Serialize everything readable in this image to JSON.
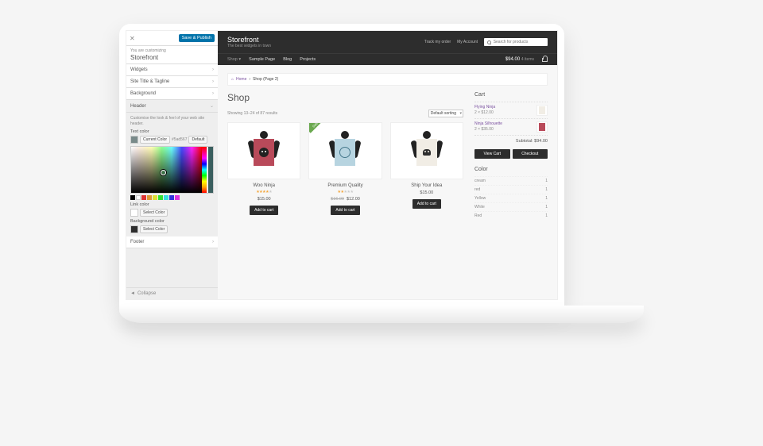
{
  "customizer": {
    "save": "Save & Publish",
    "crumb_pre": "You are customizing",
    "crumb_theme": "Storefront",
    "sections": [
      "Widgets",
      "Site Title & Tagline",
      "Background",
      "Header"
    ],
    "header": {
      "desc": "Customise the look & feel of your web site header.",
      "text_color": {
        "label": "Text color",
        "hex": "#5ad567",
        "current": "Current Color",
        "default": "Default"
      },
      "link_color": {
        "label": "Link color",
        "select": "Select Color"
      },
      "bg_color": {
        "label": "Background color",
        "select": "Select Color"
      }
    },
    "footer_section": "Footer",
    "collapse": "Collapse"
  },
  "site": {
    "brand": "Storefront",
    "tagline": "The best widgets in town",
    "links": {
      "track": "Track my order",
      "account": "My Account"
    },
    "search_placeholder": "Search for products",
    "nav": [
      "Shop",
      "Sample Page",
      "Blog",
      "Projects"
    ],
    "cart_total": "$94.00",
    "cart_items": "4 items",
    "breadcrumb": {
      "home": "Home",
      "shop": "Shop",
      "page": "(Page 2)"
    }
  },
  "shop": {
    "title": "Shop",
    "count": "Showing 13–24 of 87 results",
    "sort": "Default sorting",
    "products": [
      {
        "name": "Woo Ninja",
        "rating": 4,
        "price": "$15.00",
        "sale": false,
        "poster": "p1",
        "add": "Add to cart"
      },
      {
        "name": "Premium Quality",
        "rating": 2,
        "old": "$16.00",
        "price": "$12.00",
        "sale": true,
        "sale_label": "Sale!",
        "poster": "p2",
        "add": "Add to cart"
      },
      {
        "name": "Ship Your Idea",
        "rating": 0,
        "price": "$15.00",
        "sale": false,
        "poster": "p3",
        "add": "Add to cart"
      }
    ]
  },
  "cart": {
    "title": "Cart",
    "items": [
      {
        "name": "Flying Ninja",
        "qty": "2 × $12.00",
        "poster": "p3"
      },
      {
        "name": "Ninja Silhouette",
        "qty": "2 × $35.00",
        "poster": "p1"
      }
    ],
    "subtotal_label": "Subtotal:",
    "subtotal": "$94.00",
    "view": "View Cart",
    "checkout": "Checkout"
  },
  "colors": {
    "title": "Color",
    "rows": [
      [
        "cream",
        "1"
      ],
      [
        "red",
        "1"
      ],
      [
        "Yellow",
        "1"
      ],
      [
        "White",
        "1"
      ],
      [
        "Red",
        "1"
      ]
    ]
  }
}
